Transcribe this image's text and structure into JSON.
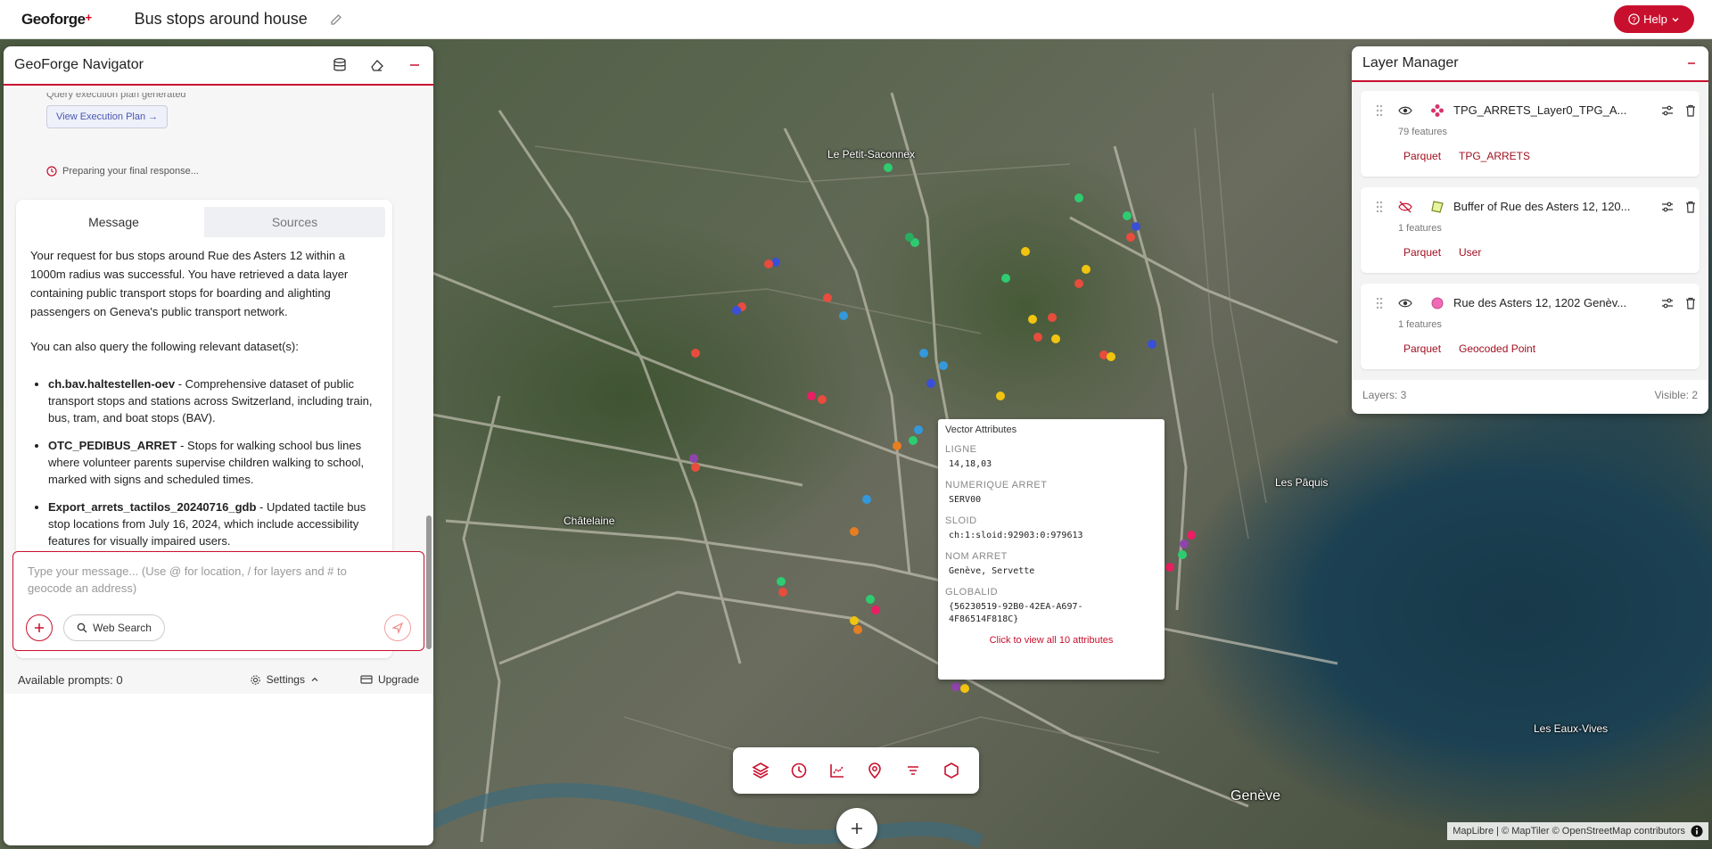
{
  "app": {
    "logo": "Geoforge",
    "title": "Bus stops around house",
    "help_label": "Help"
  },
  "navigator": {
    "title": "GeoForge Navigator",
    "exec_status": "Query execution plan generated",
    "exec_button": "View Execution Plan →",
    "preparing": "Preparing your final response...",
    "tabs": [
      "Message",
      "Sources"
    ],
    "message": {
      "intro": "Your request for bus stops around Rue des Asters 12 within a 1000m radius was successful. You have retrieved a data layer containing public transport stops for boarding and alighting passengers on Geneva's public transport network.",
      "also": "You can also query the following relevant dataset(s):",
      "datasets": [
        {
          "name": "ch.bav.haltestellen-oev",
          "desc": " - Comprehensive dataset of public transport stops and stations across Switzerland, including train, bus, tram, and boat stops (BAV)."
        },
        {
          "name": "OTC_PEDIBUS_ARRET",
          "desc": " - Stops for walking school bus lines where volunteer parents supervise children walking to school, marked with signs and scheduled times."
        },
        {
          "name": "Export_arrets_tactilos_20240716_gdb",
          "desc": " - Updated tactile bus stop locations from July 16, 2024, which include accessibility features for visually impaired users."
        }
      ]
    },
    "input_placeholder": "Type your message... (Use @ for location, / for layers and # to geocode an address)",
    "web_search": "Web Search",
    "available_prompts": "Available prompts: 0",
    "settings": "Settings",
    "upgrade": "Upgrade"
  },
  "layer_manager": {
    "title": "Layer Manager",
    "layers": [
      {
        "name": "TPG_ARRETS_Layer0_TPG_A...",
        "features": "79 features",
        "format": "Parquet",
        "source": "TPG_ARRETS",
        "visible": true
      },
      {
        "name": "Buffer of Rue des Asters 12, 120...",
        "features": "1 features",
        "format": "Parquet",
        "source": "User",
        "visible": false
      },
      {
        "name": "Rue des Asters 12, 1202 Genèv...",
        "features": "1 features",
        "format": "Parquet",
        "source": "Geocoded Point",
        "visible": true
      }
    ],
    "layers_count": "Layers: 3",
    "visible_count": "Visible: 2"
  },
  "popup": {
    "title": "Vector Attributes",
    "attributes": [
      {
        "key": "LIGNE",
        "value": "14,18,03"
      },
      {
        "key": "NUMERIQUE ARRET",
        "value": "SERV00"
      },
      {
        "key": "SLOID",
        "value": "ch:1:sloid:92903:0:979613"
      },
      {
        "key": "NOM ARRET",
        "value": "Genève, Servette"
      },
      {
        "key": "GLOBALID",
        "value": "{56230519-92B0-42EA-A697-4F86514F818C}"
      }
    ],
    "link": "Click to view all 10 attributes"
  },
  "map": {
    "labels": [
      {
        "text": "Le Petit-Saconnex"
      },
      {
        "text": "Châtelaine"
      },
      {
        "text": "Les Pâquis"
      },
      {
        "text": "Les Eaux-Vives"
      },
      {
        "text": "Genève"
      }
    ],
    "attribution": "MapLibre | © MapTiler © OpenStreetMap contributors"
  },
  "colors": {
    "accent": "#c8102e"
  }
}
